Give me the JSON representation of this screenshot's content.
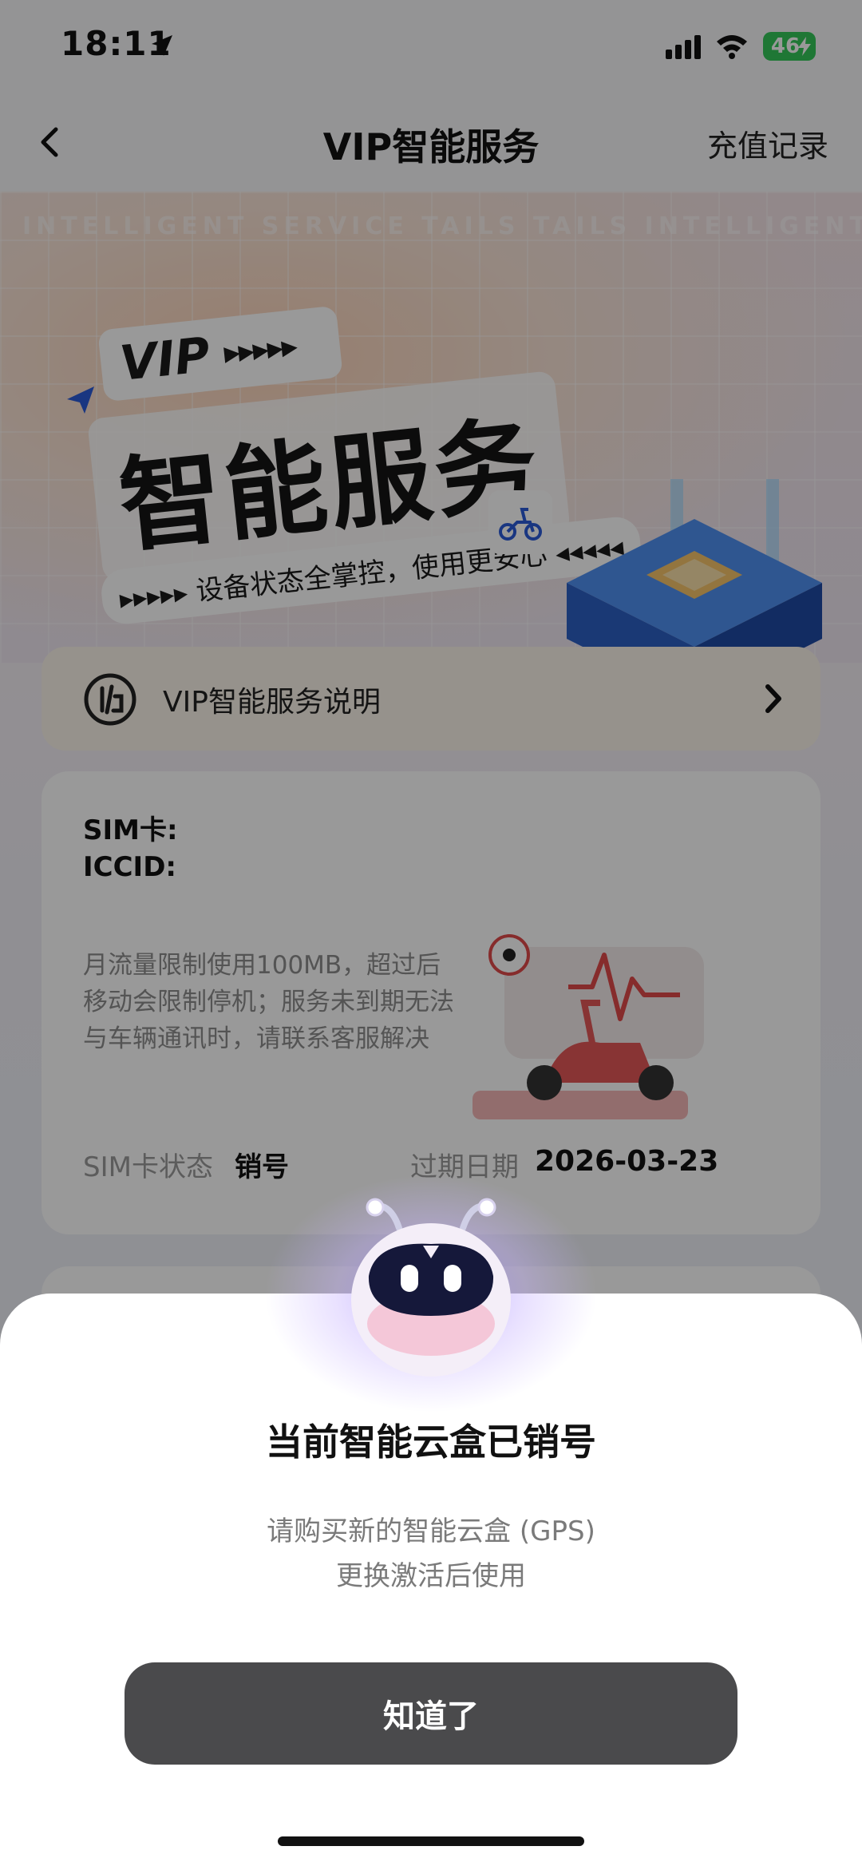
{
  "status_bar": {
    "time": "18:11",
    "battery": "46"
  },
  "nav": {
    "title": "VIP智能服务",
    "right_action": "充值记录"
  },
  "banner": {
    "deco_text": "INTELLIGENT SERVICE TAILS TAILS INTELLIGENT SERVICE",
    "vip": "VIP",
    "title": "智能服务",
    "subtitle": "设备状态全掌控，使用更安心"
  },
  "notice": {
    "label": "VIP智能服务说明"
  },
  "sim": {
    "sim_label": "SIM卡:",
    "iccid_label": "ICCID:",
    "description": "月流量限制使用100MB，超过后移动会限制停机；服务未到期无法与车辆通讯时，请联系客服解决",
    "state_label": "SIM卡状态",
    "state_value": "销号",
    "expire_label": "过期日期",
    "expire_value": "2026-03-23"
  },
  "dialog": {
    "title": "当前智能云盒已销号",
    "line1": "请购买新的智能云盒 (GPS)",
    "line2": "更换激活后使用",
    "button": "知道了"
  },
  "colors": {
    "accent_dark": "#4a4a4c",
    "battery_green": "#34c759",
    "notice_bg": "#fbf4ea"
  },
  "icons": [
    "location-arrow-icon",
    "cellular-signal-icon",
    "wifi-icon",
    "battery-icon",
    "back-chevron-icon",
    "service-info-icon",
    "chevron-right-icon",
    "scooter-icon",
    "robot-mascot-icon"
  ]
}
